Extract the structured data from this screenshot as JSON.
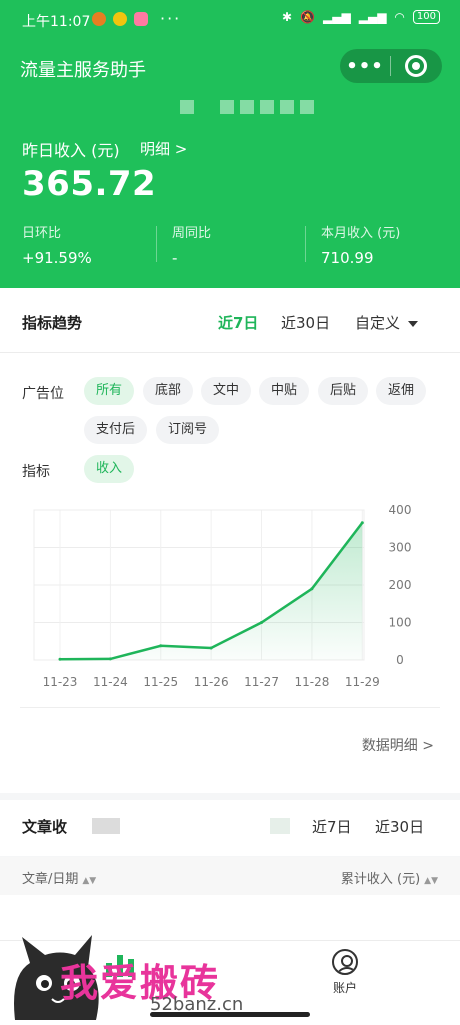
{
  "status_bar": {
    "time": "上午11:07",
    "dots": "···",
    "battery": "100"
  },
  "header": {
    "title": "流量主服务助手",
    "more": "•••"
  },
  "summary": {
    "yesterday_label": "昨日收入 (元)",
    "detail_link": "明细 >",
    "yesterday_value": "365.72",
    "daily_label": "日环比",
    "daily_value": "+91.59%",
    "weekly_label": "周同比",
    "weekly_value": "-",
    "month_label": "本月收入 (元)",
    "month_value": "710.99"
  },
  "trend": {
    "title": "指标趋势",
    "range_7": "近7日",
    "range_30": "近30日",
    "range_custom": "自定义",
    "ad_label": "广告位",
    "ad_chips": [
      "所有",
      "底部",
      "文中",
      "中贴",
      "后贴",
      "返佣",
      "支付后",
      "订阅号"
    ],
    "metric_label": "指标",
    "metric_chip": "收入",
    "data_detail": "数据明细 >"
  },
  "chart_data": {
    "type": "line",
    "categories": [
      "11-23",
      "11-24",
      "11-25",
      "11-26",
      "11-27",
      "11-28",
      "11-29"
    ],
    "values": [
      2,
      3,
      38,
      32,
      100,
      190,
      366
    ],
    "y_ticks": [
      "0",
      "100",
      "200",
      "300",
      "400"
    ],
    "ylim": [
      0,
      400
    ],
    "grid": true,
    "color": "#1fb55a"
  },
  "articles": {
    "title": "文章收",
    "range_7": "近7日",
    "range_30": "近30日",
    "col_left": "文章/日期",
    "col_right": "累计收入 (元)"
  },
  "tabbar": {
    "account": "账户"
  },
  "watermark": {
    "text": "我爱搬砖",
    "site": "52banz.cn"
  }
}
